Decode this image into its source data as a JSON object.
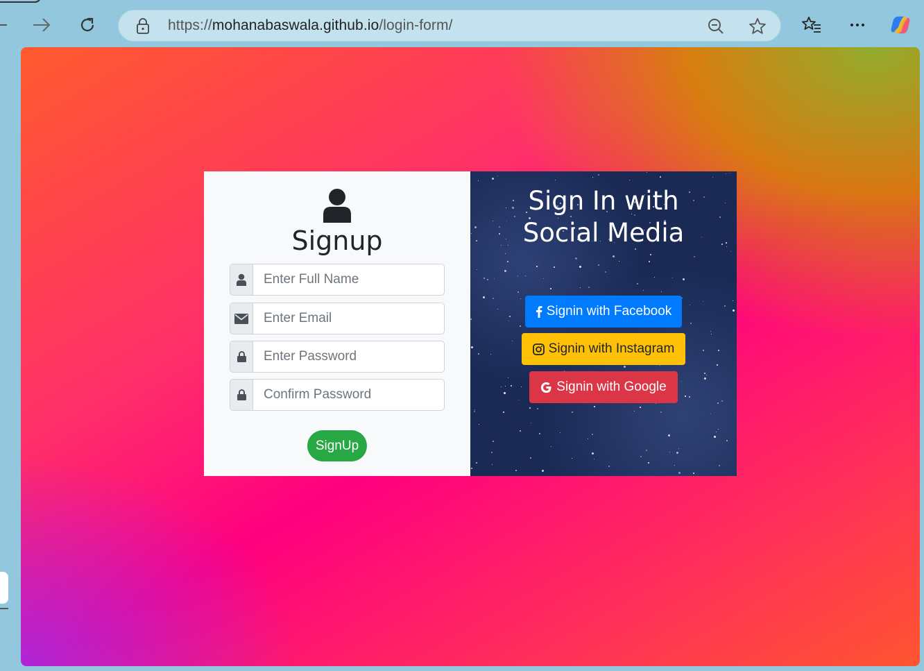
{
  "browser": {
    "url_prefix": "https://",
    "url_host": "mohanabaswala.github.io",
    "url_path": "/login-form/"
  },
  "signup": {
    "title": "Signup",
    "fields": [
      {
        "placeholder": "Enter Full Name",
        "icon": "user-icon"
      },
      {
        "placeholder": "Enter Email",
        "icon": "envelope-icon"
      },
      {
        "placeholder": "Enter Password",
        "icon": "lock-icon"
      },
      {
        "placeholder": "Confirm Password",
        "icon": "lock-icon"
      }
    ],
    "button_label": "SignUp"
  },
  "social": {
    "title_line1": "Sign In with",
    "title_line2": "Social Media",
    "facebook_label": "Signin with Facebook",
    "instagram_label": "Signin with Instagram",
    "google_label": "Signin with Google"
  },
  "colors": {
    "signup_button": "#28a745",
    "facebook": "#007bff",
    "instagram": "#ffc107",
    "google": "#dc3545"
  }
}
